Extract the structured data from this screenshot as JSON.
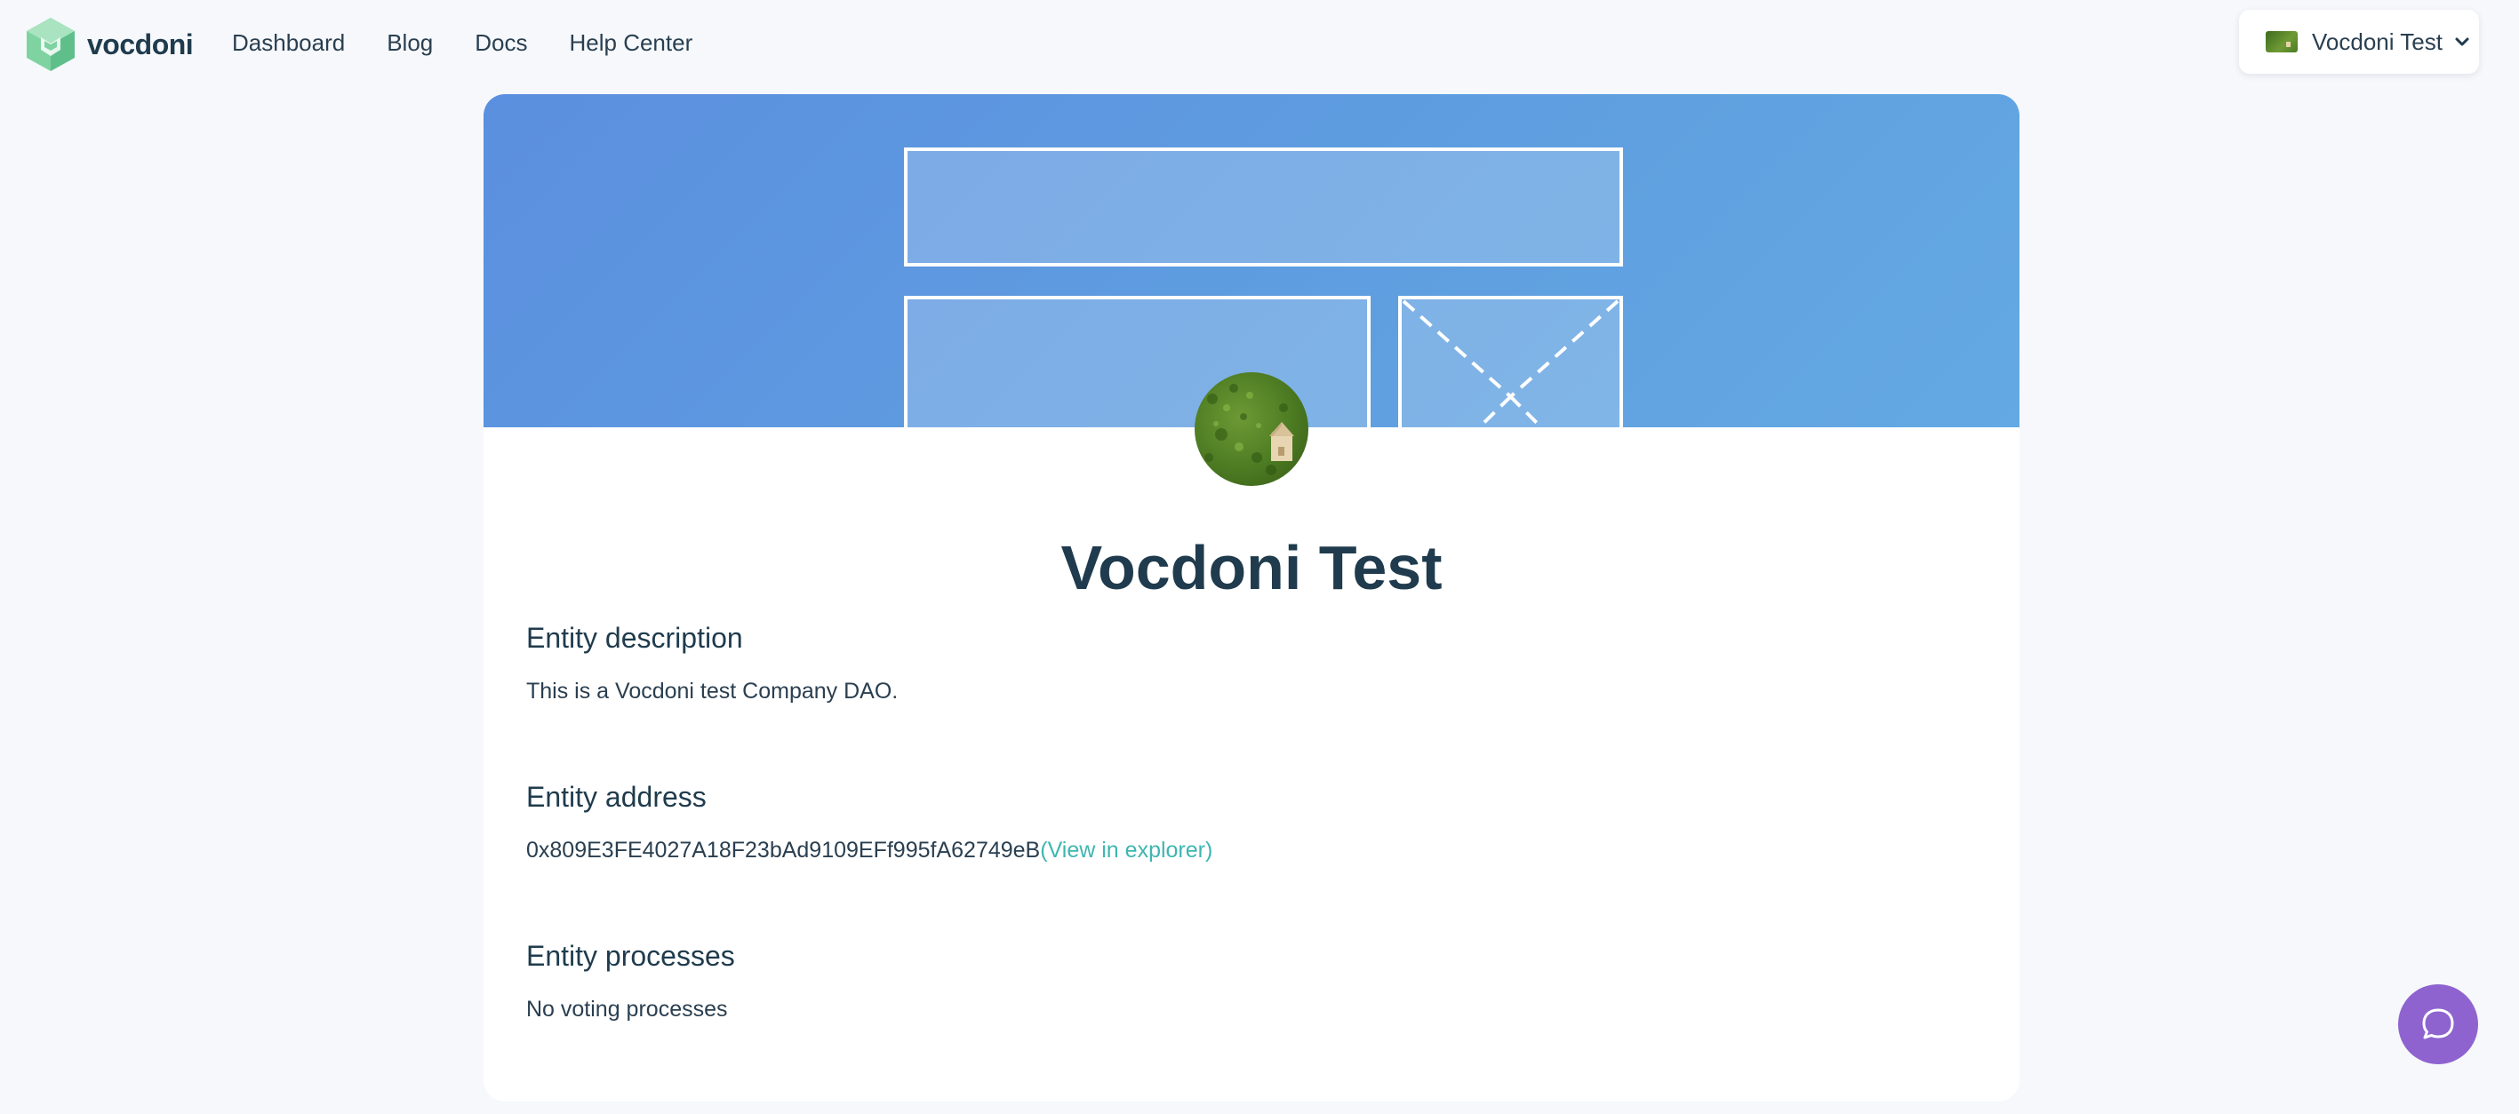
{
  "brand": {
    "name": "vocdoni",
    "logo_icon": "vocdoni-cube-logo",
    "colors": {
      "primary_text": "#1f3b4d",
      "link_accent": "#3fb6b0",
      "banner_blue": "#5f9fe0",
      "help_purple": "#8f63cf",
      "logo_green": "#7ed3a0"
    }
  },
  "nav": {
    "items": [
      {
        "label": "Dashboard"
      },
      {
        "label": "Blog"
      },
      {
        "label": "Docs"
      },
      {
        "label": "Help Center"
      }
    ]
  },
  "account": {
    "name": "Vocdoni Test",
    "chevron_icon": "chevron-down-icon"
  },
  "profile": {
    "banner_icon": "layout-placeholder-image",
    "avatar_icon": "house-on-grass-avatar",
    "title": "Vocdoni Test",
    "description": {
      "heading": "Entity description",
      "text": "This is a Vocdoni test Company DAO."
    },
    "address": {
      "heading": "Entity address",
      "value": "0x809E3FE4027A18F23bAd9109EFf995fA62749eB",
      "link_label": "(View in explorer)"
    },
    "processes": {
      "heading": "Entity processes",
      "empty_text": "No voting processes"
    }
  },
  "help": {
    "icon": "chat-bubble-icon"
  }
}
